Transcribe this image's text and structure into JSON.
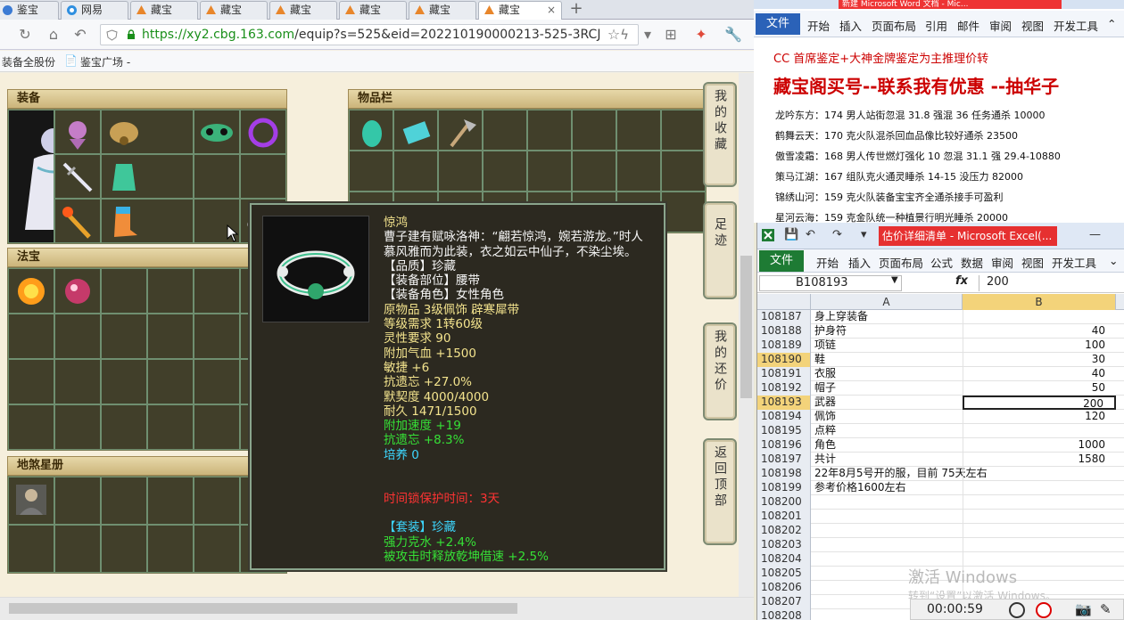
{
  "browser": {
    "tabs": [
      {
        "label": "鉴宝"
      },
      {
        "label": "网易"
      },
      {
        "label": "藏宝"
      },
      {
        "label": "藏宝"
      },
      {
        "label": "藏宝"
      },
      {
        "label": "藏宝"
      },
      {
        "label": "藏宝"
      },
      {
        "label": "藏宝"
      }
    ],
    "url_host": "https://xy2.cbg.163.com",
    "url_path": "/equip?s=525&eid=202210190000213-525-3RCJ",
    "bookmarks": [
      "装备全股份",
      "鉴宝广场 -"
    ]
  },
  "game": {
    "panels": {
      "equip": "装备",
      "inventory": "物品栏",
      "magic": "法宝",
      "book": "地煞星册"
    },
    "tooltip": {
      "name": "惊鸿",
      "lines": [
        {
          "text": "曹子建有赋咏洛神：“翩若惊鸿，婉若游龙。”时人",
          "color": "white"
        },
        {
          "text": "慕风雅而为此装，衣之如云中仙子，不染尘埃。",
          "color": "white"
        },
        {
          "text": "【品质】珍藏",
          "color": "white"
        },
        {
          "text": "【装备部位】腰带",
          "color": "white"
        },
        {
          "text": "【装备角色】女性角色",
          "color": "white"
        },
        {
          "text": "原物品 3级佩饰 辟寒犀带",
          "color": "yellow"
        },
        {
          "text": "等级需求 1转60级",
          "color": "yellow"
        },
        {
          "text": "灵性要求 90",
          "color": "yellow"
        },
        {
          "text": "附加气血 +1500",
          "color": "yellow"
        },
        {
          "text": "敏捷 +6",
          "color": "yellow"
        },
        {
          "text": "抗遗忘 +27.0%",
          "color": "yellow"
        },
        {
          "text": "默契度 4000/4000",
          "color": "yellow"
        },
        {
          "text": "耐久 1471/1500",
          "color": "yellow"
        },
        {
          "text": "附加速度 +19",
          "color": "green"
        },
        {
          "text": "抗遗忘 +8.3%",
          "color": "green"
        },
        {
          "text": "培养 0",
          "color": "cyan"
        },
        {
          "text": "",
          "color": "white"
        },
        {
          "text": "",
          "color": "white"
        },
        {
          "text": "时间锁保护时间：3天",
          "color": "red"
        },
        {
          "text": "",
          "color": "white"
        },
        {
          "text": "【套装】珍藏",
          "color": "cyan"
        },
        {
          "text": "强力克水 +2.4%",
          "color": "green"
        },
        {
          "text": "被攻击时释放乾坤借速 +2.5%",
          "color": "green"
        }
      ]
    },
    "side_buttons": [
      "我的收藏",
      "足迹",
      "我的还价",
      "返回顶部"
    ]
  },
  "word": {
    "title": "新建 Microsoft Word 文档 - Mic...",
    "file_label": "文件",
    "tabs": [
      "开始",
      "插入",
      "页面布局",
      "引用",
      "邮件",
      "审阅",
      "视图",
      "开发工具"
    ],
    "heading1": "CC 首席鉴定+大神金牌鉴定为主推理价转",
    "heading2": "藏宝阁买号--联系我有优惠 --抽华子",
    "lines": [
      "龙吟东方：174 男人站街忽混 31.8 强混 36 任务通杀 10000",
      "鹤舞云天：170 克火队混杀回血品像比较好通杀 23500",
      "傲雪凌霜：168 男人传世燃灯强化 10 忽混 31.1 强 29.4-10880",
      "策马江湖：167 组队克火通灵睡杀 14-15 没压力 82000",
      "锦绣山河：159 克火队装备宝宝齐全通杀接手可盈利",
      "星河云海：159 克金队统一种植景行明光睡杀 20000"
    ]
  },
  "excel": {
    "title": "估价详细清单 - Microsoft Excel(...",
    "file_label": "文件",
    "tabs": [
      "开始",
      "插入",
      "页面布局",
      "公式",
      "数据",
      "审阅",
      "视图",
      "开发工具"
    ],
    "namebox": "B108193",
    "formula_value": "200",
    "col_a": "A",
    "col_b": "B",
    "rows": [
      {
        "n": "108187",
        "a": "身上穿装备",
        "b": ""
      },
      {
        "n": "108188",
        "a": "护身符",
        "b": "40"
      },
      {
        "n": "108189",
        "a": "项链",
        "b": "100"
      },
      {
        "n": "108190",
        "a": "鞋",
        "b": "30"
      },
      {
        "n": "108191",
        "a": "衣服",
        "b": "40"
      },
      {
        "n": "108192",
        "a": "帽子",
        "b": "50"
      },
      {
        "n": "108193",
        "a": "武器",
        "b": "200"
      },
      {
        "n": "108194",
        "a": "佩饰",
        "b": "120"
      },
      {
        "n": "108195",
        "a": "点粹",
        "b": ""
      },
      {
        "n": "108196",
        "a": "角色",
        "b": "1000"
      },
      {
        "n": "108197",
        "a": "共计",
        "b": "1580"
      },
      {
        "n": "108198",
        "a": "22年8月5号开的服，目前  75天左右",
        "b": ""
      },
      {
        "n": "108199",
        "a": "参考价格1600左右",
        "b": ""
      },
      {
        "n": "108200",
        "a": "",
        "b": ""
      },
      {
        "n": "108201",
        "a": "",
        "b": ""
      },
      {
        "n": "108202",
        "a": "",
        "b": ""
      },
      {
        "n": "108203",
        "a": "",
        "b": ""
      },
      {
        "n": "108204",
        "a": "",
        "b": ""
      },
      {
        "n": "108205",
        "a": "",
        "b": ""
      },
      {
        "n": "108206",
        "a": "",
        "b": ""
      },
      {
        "n": "108207",
        "a": "",
        "b": ""
      },
      {
        "n": "108208",
        "a": "",
        "b": ""
      }
    ]
  },
  "overlay": {
    "watermark": "激活 Windows",
    "watermark_sub": "转到“设置”以激活 Windows。",
    "rec_time": "00:00:59"
  }
}
